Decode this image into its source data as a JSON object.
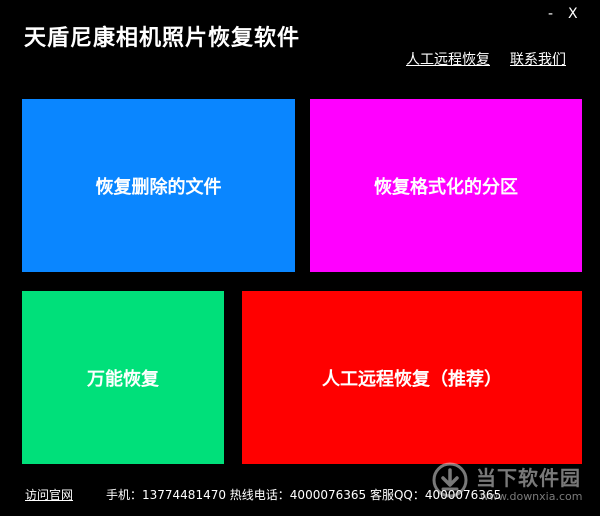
{
  "window": {
    "title": "天盾尼康相机照片恢复软件",
    "minimize_label": "-",
    "close_label": "X"
  },
  "header_links": {
    "remote_recovery": "人工远程恢复",
    "contact_us": "联系我们"
  },
  "tiles": [
    {
      "label": "恢复删除的文件",
      "color": "#0a86ff"
    },
    {
      "label": "恢复格式化的分区",
      "color": "#ff00ff"
    },
    {
      "label": "万能恢复",
      "color": "#00e07a"
    },
    {
      "label": "人工远程恢复（推荐）",
      "color": "#ff0000"
    }
  ],
  "footer": {
    "visit_site": "访问官网",
    "contact_info": "手机：13774481470 热线电话：4000076365 客服QQ：4000076365"
  },
  "watermark": {
    "name": "当下软件园",
    "url": "www.downxia.com",
    "icon": "download-arrow-icon"
  }
}
